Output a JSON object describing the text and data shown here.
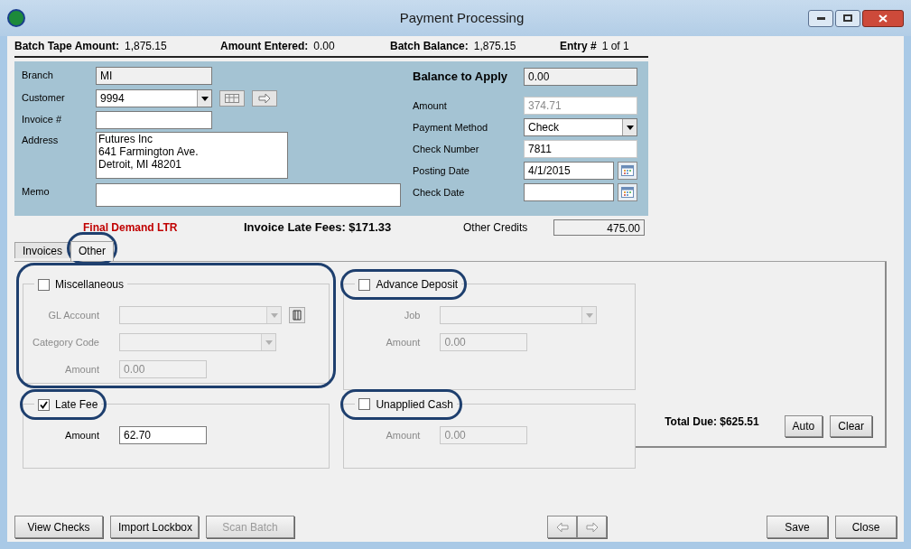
{
  "window": {
    "title": "Payment Processing"
  },
  "batch": [
    {
      "label": "Batch Tape Amount:",
      "value": "1,875.15"
    },
    {
      "label": "Amount Entered:",
      "value": "0.00"
    },
    {
      "label": "Batch Balance:",
      "value": "1,875.15"
    },
    {
      "label": "Entry #",
      "value": "1 of 1"
    }
  ],
  "customer_fields": [
    {
      "label": "Branch",
      "kind": "readonly",
      "value": "MI"
    },
    {
      "label": "Customer",
      "kind": "combo",
      "value": "9994"
    },
    {
      "label": "Invoice #",
      "kind": "text"
    },
    {
      "label": "Address",
      "kind": "multiline",
      "lines": [
        "Futures  Inc",
        "641 Farmington Ave.",
        "Detroit, MI  48201"
      ]
    },
    {
      "label": "Memo",
      "kind": "wide"
    }
  ],
  "balance_to_apply": {
    "label": "Balance to Apply",
    "value": "0.00"
  },
  "payment_fields": [
    {
      "label": "Amount",
      "kind": "text",
      "value": "374.71",
      "disabled": true
    },
    {
      "label": "Payment Method",
      "kind": "combo",
      "value": "Check",
      "disabled": false
    },
    {
      "label": "Check Number",
      "kind": "text",
      "value": "7811",
      "disabled": false
    },
    {
      "label": "Posting Date",
      "kind": "date",
      "value": "4/1/2015",
      "disabled": false
    },
    {
      "label": "Check Date",
      "kind": "date",
      "disabled": false
    }
  ],
  "status": {
    "alert": "Final Demand LTR",
    "late_fees": "Invoice Late Fees: $171.33",
    "other_credits": {
      "label": "Other Credits",
      "value": "475.00"
    }
  },
  "tabs": [
    {
      "label": "Invoices",
      "selected": false
    },
    {
      "label": "Other",
      "selected": true,
      "highlighted": true
    }
  ],
  "sections": [
    {
      "title": "Miscellaneous",
      "checked": false,
      "highlighted_group": true,
      "fields": [
        {
          "label": "GL Account",
          "kind": "lookup",
          "disabled": true
        },
        {
          "label": "Category Code",
          "kind": "combo",
          "disabled": true
        },
        {
          "label": "Amount",
          "kind": "text",
          "value": "0.00",
          "disabled": true
        }
      ]
    },
    {
      "title": "Advance Deposit",
      "checked": false,
      "highlighted_title": true,
      "fields": [
        {
          "label": "Job",
          "kind": "combo",
          "disabled": true
        },
        {
          "label": "Amount",
          "kind": "text",
          "value": "0.00",
          "disabled": true
        }
      ]
    },
    {
      "title": "Late Fee",
      "checked": true,
      "highlighted_title": true,
      "fields": [
        {
          "label": "Amount",
          "kind": "text",
          "value": "62.70",
          "disabled": false
        }
      ]
    },
    {
      "title": "Unapplied Cash",
      "checked": false,
      "highlighted_title": true,
      "fields": [
        {
          "label": "Amount",
          "kind": "text",
          "value": "0.00",
          "disabled": true
        }
      ]
    }
  ],
  "total_due": "Total Due: $625.51",
  "tab_buttons": [
    {
      "label": "Auto"
    },
    {
      "label": "Clear"
    }
  ],
  "footer_left": [
    {
      "label": "View Checks",
      "disabled": false
    },
    {
      "label": "Import Lockbox",
      "disabled": false
    },
    {
      "label": "Scan Batch",
      "disabled": true
    }
  ],
  "footer_right": [
    {
      "label": "Save",
      "disabled": false
    },
    {
      "label": "Close",
      "disabled": false
    }
  ]
}
